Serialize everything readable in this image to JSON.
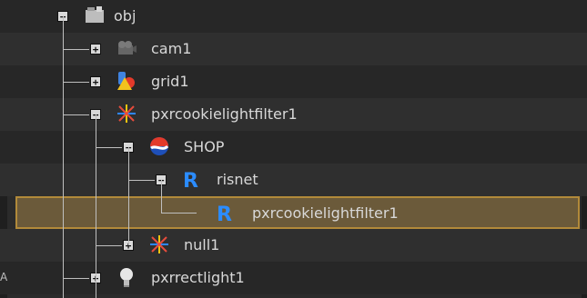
{
  "tree": {
    "root": {
      "label": "obj",
      "expander": "−"
    },
    "items": [
      {
        "label": "cam1",
        "expander": "+"
      },
      {
        "label": "grid1",
        "expander": "+"
      },
      {
        "label": "pxrcookielightfilter1",
        "expander": "−"
      },
      {
        "label": "SHOP",
        "expander": "−"
      },
      {
        "label": "risnet",
        "expander": "−"
      },
      {
        "label": "pxrcookielightfilter1",
        "expander": ""
      },
      {
        "label": "null1",
        "expander": "+"
      },
      {
        "label": "pxrrectlight1",
        "expander": "+"
      }
    ]
  },
  "icons": {
    "obj": "folder-node-icon",
    "cam1": "camera-icon",
    "grid1": "geometry-icon",
    "filter": "light-filter-icon",
    "shop": "shop-icon",
    "risnet": "renderman-icon",
    "null": "null-icon",
    "rectlight": "light-bulb-icon"
  },
  "colors": {
    "selection_fill": "#6b5a3a",
    "selection_border": "#b28a3a"
  },
  "status": {
    "edge_marker": "A"
  }
}
